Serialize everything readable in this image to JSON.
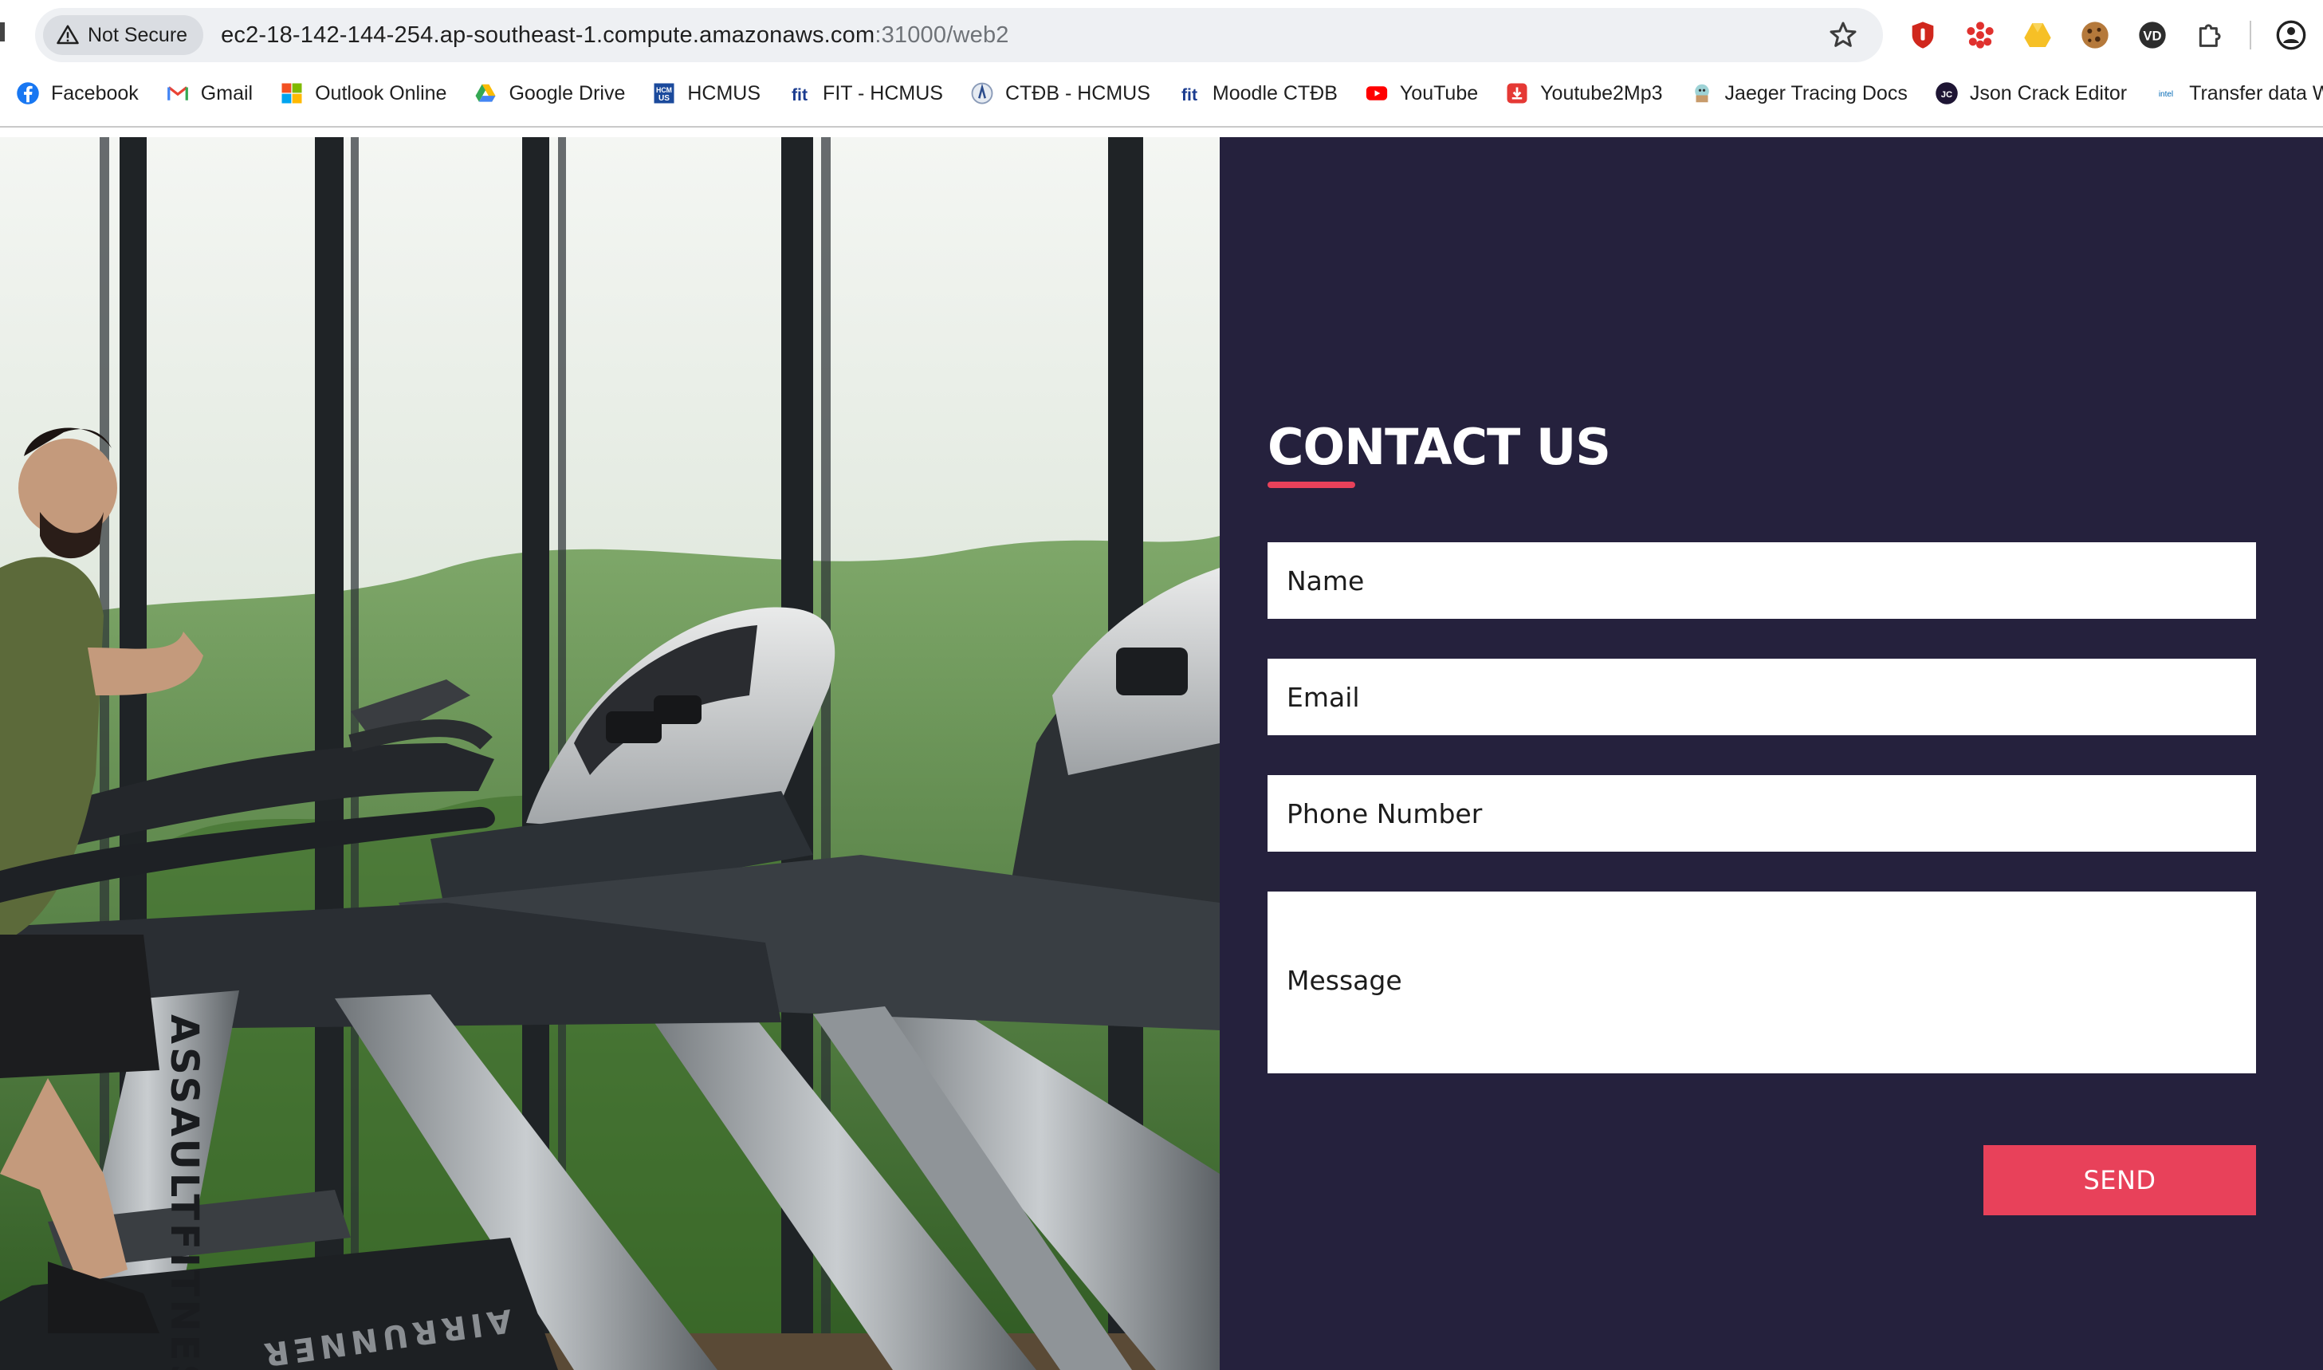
{
  "browser": {
    "security_label": "Not Secure",
    "url_host": "ec2-18-142-144-254.ap-southeast-1.compute.amazonaws.com",
    "url_rest": ":31000/web2",
    "extensions": [
      "ublock-icon",
      "asterisk-extension-icon",
      "drive-extension-icon",
      "cookie-icon",
      "vd-extension-icon",
      "puzzle-icon",
      "profile-icon"
    ]
  },
  "bookmarks": [
    {
      "label": "Facebook",
      "icon": "facebook-icon"
    },
    {
      "label": "Gmail",
      "icon": "gmail-icon"
    },
    {
      "label": "Outlook Online",
      "icon": "microsoft-icon"
    },
    {
      "label": "Google Drive",
      "icon": "google-drive-icon"
    },
    {
      "label": "HCMUS",
      "icon": "hcmus-icon"
    },
    {
      "label": "FIT - HCMUS",
      "icon": "fit-icon"
    },
    {
      "label": "CTĐB - HCMUS",
      "icon": "ctdb-icon"
    },
    {
      "label": "Moodle CTĐB",
      "icon": "fit-icon"
    },
    {
      "label": "YouTube",
      "icon": "youtube-icon"
    },
    {
      "label": "Youtube2Mp3",
      "icon": "download-icon"
    },
    {
      "label": "Jaeger Tracing Docs",
      "icon": "jaeger-icon"
    },
    {
      "label": "Json Crack Editor",
      "icon": "jsoncrack-icon"
    },
    {
      "label": "Transfer data W",
      "icon": "intel-icon"
    }
  ],
  "hero": {
    "treadmill_brand_vertical": "ASSAULTFITNESS",
    "treadmill_brand_base": "AIRRUNNER"
  },
  "contact": {
    "title": "CONTACT US",
    "name_placeholder": "Name",
    "email_placeholder": "Email",
    "phone_placeholder": "Phone Number",
    "message_placeholder": "Message",
    "send_label": "SEND"
  },
  "colors": {
    "panel_bg": "#25213d",
    "accent": "#e8415a"
  }
}
